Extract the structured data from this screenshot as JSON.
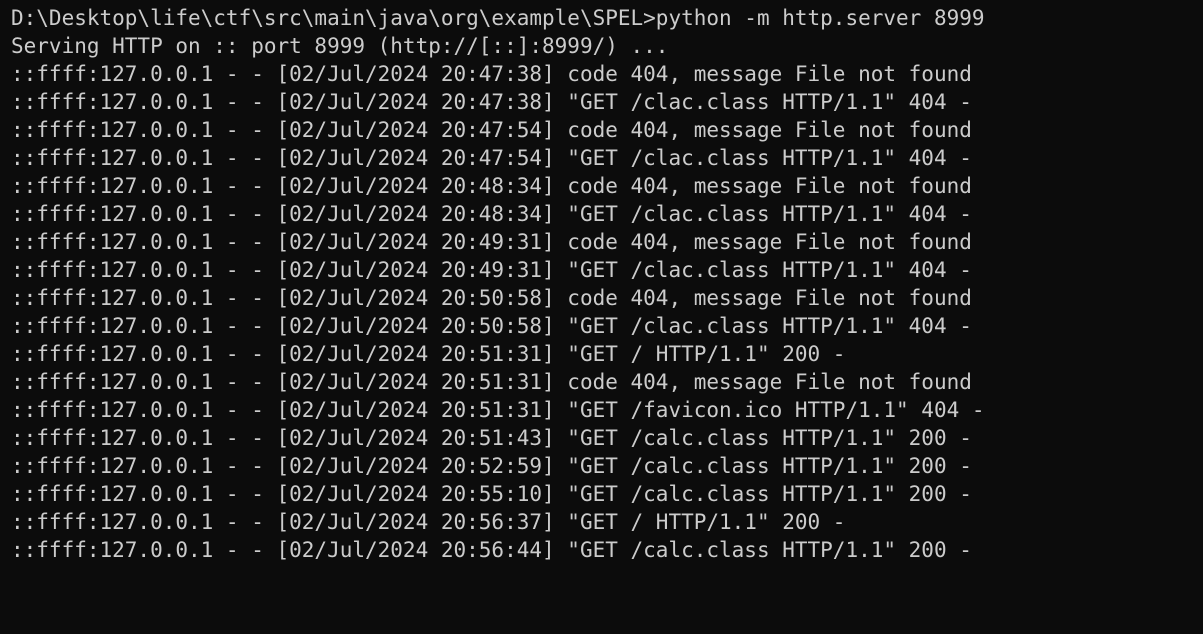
{
  "terminal": {
    "colors": {
      "background": "#0c0c0c",
      "foreground": "#cccccc"
    },
    "lines": [
      "D:\\Desktop\\life\\ctf\\src\\main\\java\\org\\example\\SPEL>python -m http.server 8999",
      "Serving HTTP on :: port 8999 (http://[::]:8999/) ...",
      "::ffff:127.0.0.1 - - [02/Jul/2024 20:47:38] code 404, message File not found",
      "::ffff:127.0.0.1 - - [02/Jul/2024 20:47:38] \"GET /clac.class HTTP/1.1\" 404 -",
      "::ffff:127.0.0.1 - - [02/Jul/2024 20:47:54] code 404, message File not found",
      "::ffff:127.0.0.1 - - [02/Jul/2024 20:47:54] \"GET /clac.class HTTP/1.1\" 404 -",
      "::ffff:127.0.0.1 - - [02/Jul/2024 20:48:34] code 404, message File not found",
      "::ffff:127.0.0.1 - - [02/Jul/2024 20:48:34] \"GET /clac.class HTTP/1.1\" 404 -",
      "::ffff:127.0.0.1 - - [02/Jul/2024 20:49:31] code 404, message File not found",
      "::ffff:127.0.0.1 - - [02/Jul/2024 20:49:31] \"GET /clac.class HTTP/1.1\" 404 -",
      "::ffff:127.0.0.1 - - [02/Jul/2024 20:50:58] code 404, message File not found",
      "::ffff:127.0.0.1 - - [02/Jul/2024 20:50:58] \"GET /clac.class HTTP/1.1\" 404 -",
      "::ffff:127.0.0.1 - - [02/Jul/2024 20:51:31] \"GET / HTTP/1.1\" 200 -",
      "::ffff:127.0.0.1 - - [02/Jul/2024 20:51:31] code 404, message File not found",
      "::ffff:127.0.0.1 - - [02/Jul/2024 20:51:31] \"GET /favicon.ico HTTP/1.1\" 404 -",
      "::ffff:127.0.0.1 - - [02/Jul/2024 20:51:43] \"GET /calc.class HTTP/1.1\" 200 -",
      "::ffff:127.0.0.1 - - [02/Jul/2024 20:52:59] \"GET /calc.class HTTP/1.1\" 200 -",
      "::ffff:127.0.0.1 - - [02/Jul/2024 20:55:10] \"GET /calc.class HTTP/1.1\" 200 -",
      "::ffff:127.0.0.1 - - [02/Jul/2024 20:56:37] \"GET / HTTP/1.1\" 200 -",
      "::ffff:127.0.0.1 - - [02/Jul/2024 20:56:44] \"GET /calc.class HTTP/1.1\" 200 -"
    ]
  }
}
